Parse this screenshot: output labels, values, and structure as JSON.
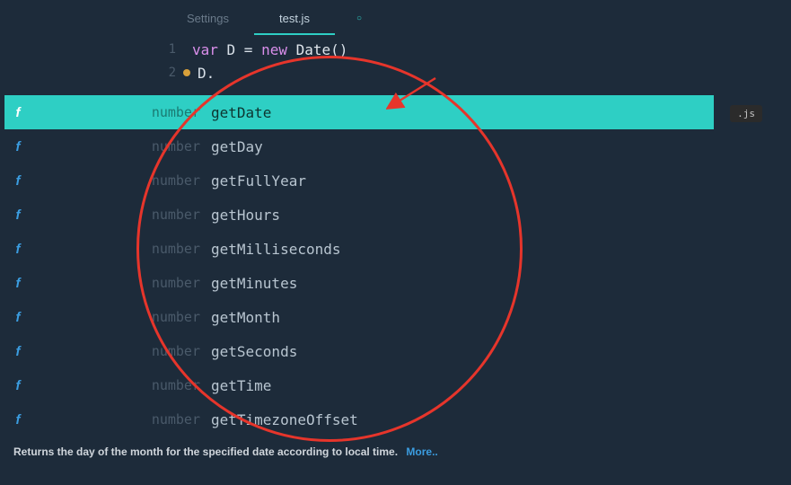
{
  "tabs": {
    "settings": "Settings",
    "active": "test.js",
    "indicator": "○"
  },
  "code": {
    "line1_num": "1",
    "line1_var": "var",
    "line1_mid": " D = ",
    "line1_new": "new",
    "line1_cls": " Date",
    "line1_end": "()",
    "line2_num": "2",
    "line2_code": "D."
  },
  "ac_icon": "f",
  "ac": [
    {
      "type": "number",
      "name": "getDate"
    },
    {
      "type": "number",
      "name": "getDay"
    },
    {
      "type": "number",
      "name": "getFullYear"
    },
    {
      "type": "number",
      "name": "getHours"
    },
    {
      "type": "number",
      "name": "getMilliseconds"
    },
    {
      "type": "number",
      "name": "getMinutes"
    },
    {
      "type": "number",
      "name": "getMonth"
    },
    {
      "type": "number",
      "name": "getSeconds"
    },
    {
      "type": "number",
      "name": "getTime"
    },
    {
      "type": "number",
      "name": "getTimezoneOffset"
    }
  ],
  "doc": {
    "text": "Returns the day of the month for the specified date according to local time.",
    "more": "More.."
  },
  "badge": ".js"
}
